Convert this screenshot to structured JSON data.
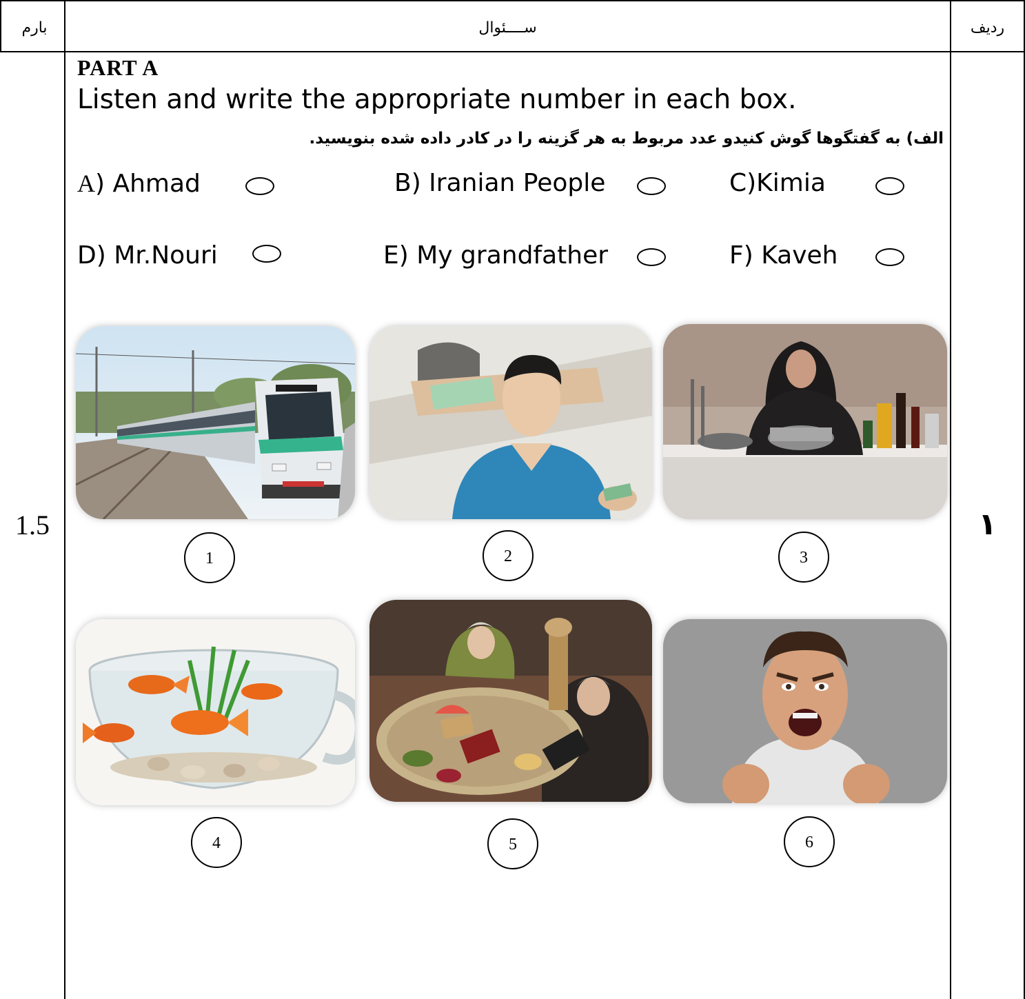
{
  "header": {
    "score_label": "بارم",
    "question_label": "ســــئوال",
    "row_label": "ردیف"
  },
  "row": {
    "score": "1.5",
    "number": "۱"
  },
  "part_a": {
    "title": "PART A",
    "instruction": "Listen and write the appropriate number in each box.",
    "instruction_fa": "الف) به گفتگوها گوش کنیدو عدد مربوط به هر گزینه را در کادر داده شده بنویسید."
  },
  "options": [
    {
      "letter": "A",
      "text": ") Ahmad"
    },
    {
      "text": "B) Iranian People"
    },
    {
      "text": "C)Kimia"
    },
    {
      "text": "D) Mr.Nouri"
    },
    {
      "text": "E) My grandfather"
    },
    {
      "text": "F) Kaveh"
    }
  ],
  "pictures": [
    {
      "number": "1",
      "subject": "train"
    },
    {
      "number": "2",
      "subject": "man-with-money"
    },
    {
      "number": "3",
      "subject": "woman-cooking"
    },
    {
      "number": "4",
      "subject": "goldfish-bowl"
    },
    {
      "number": "5",
      "subject": "nowruz-table"
    },
    {
      "number": "6",
      "subject": "angry-man"
    }
  ]
}
